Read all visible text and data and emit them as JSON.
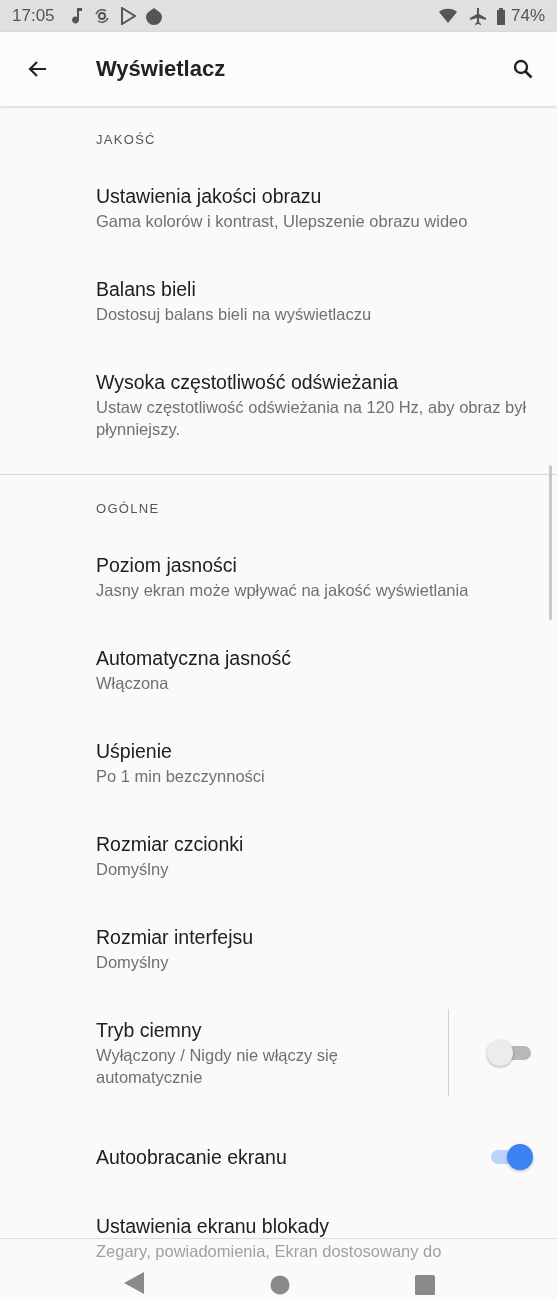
{
  "status_bar": {
    "time": "17:05",
    "battery": "74%"
  },
  "app_bar": {
    "title": "Wyświetlacz"
  },
  "sections": [
    {
      "header": "JAKOŚĆ",
      "items": [
        {
          "kind": "text",
          "title": "Ustawienia jakości obrazu",
          "summary": "Gama kolorów i kontrast, Ulepszenie obrazu wideo"
        },
        {
          "kind": "text",
          "title": "Balans bieli",
          "summary": "Dostosuj balans bieli na wyświetlaczu"
        },
        {
          "kind": "text",
          "title": "Wysoka częstotliwość odświeżania",
          "summary": "Ustaw częstotliwość odświeżania na 120 Hz, aby obraz był płynniejszy."
        }
      ]
    },
    {
      "header": "OGÓLNE",
      "items": [
        {
          "kind": "text",
          "title": "Poziom jasności",
          "summary": "Jasny ekran może wpływać na jakość wyświetlania"
        },
        {
          "kind": "text",
          "title": "Automatyczna jasność",
          "summary": "Włączona"
        },
        {
          "kind": "text",
          "title": "Uśpienie",
          "summary": "Po 1 min bezczynności"
        },
        {
          "kind": "text",
          "title": "Rozmiar czcionki",
          "summary": "Domyślny"
        },
        {
          "kind": "text",
          "title": "Rozmiar interfejsu",
          "summary": "Domyślny"
        },
        {
          "kind": "split-switch",
          "title": "Tryb ciemny",
          "summary": "Wyłączony / Nigdy nie włączy się automatycznie",
          "on": false
        },
        {
          "kind": "switch",
          "title": "Autoobracanie ekranu",
          "on": true
        },
        {
          "kind": "text",
          "title": "Ustawienia ekranu blokady",
          "summary": "Zegary, powiadomienia, Ekran dostosowany do"
        }
      ]
    }
  ]
}
